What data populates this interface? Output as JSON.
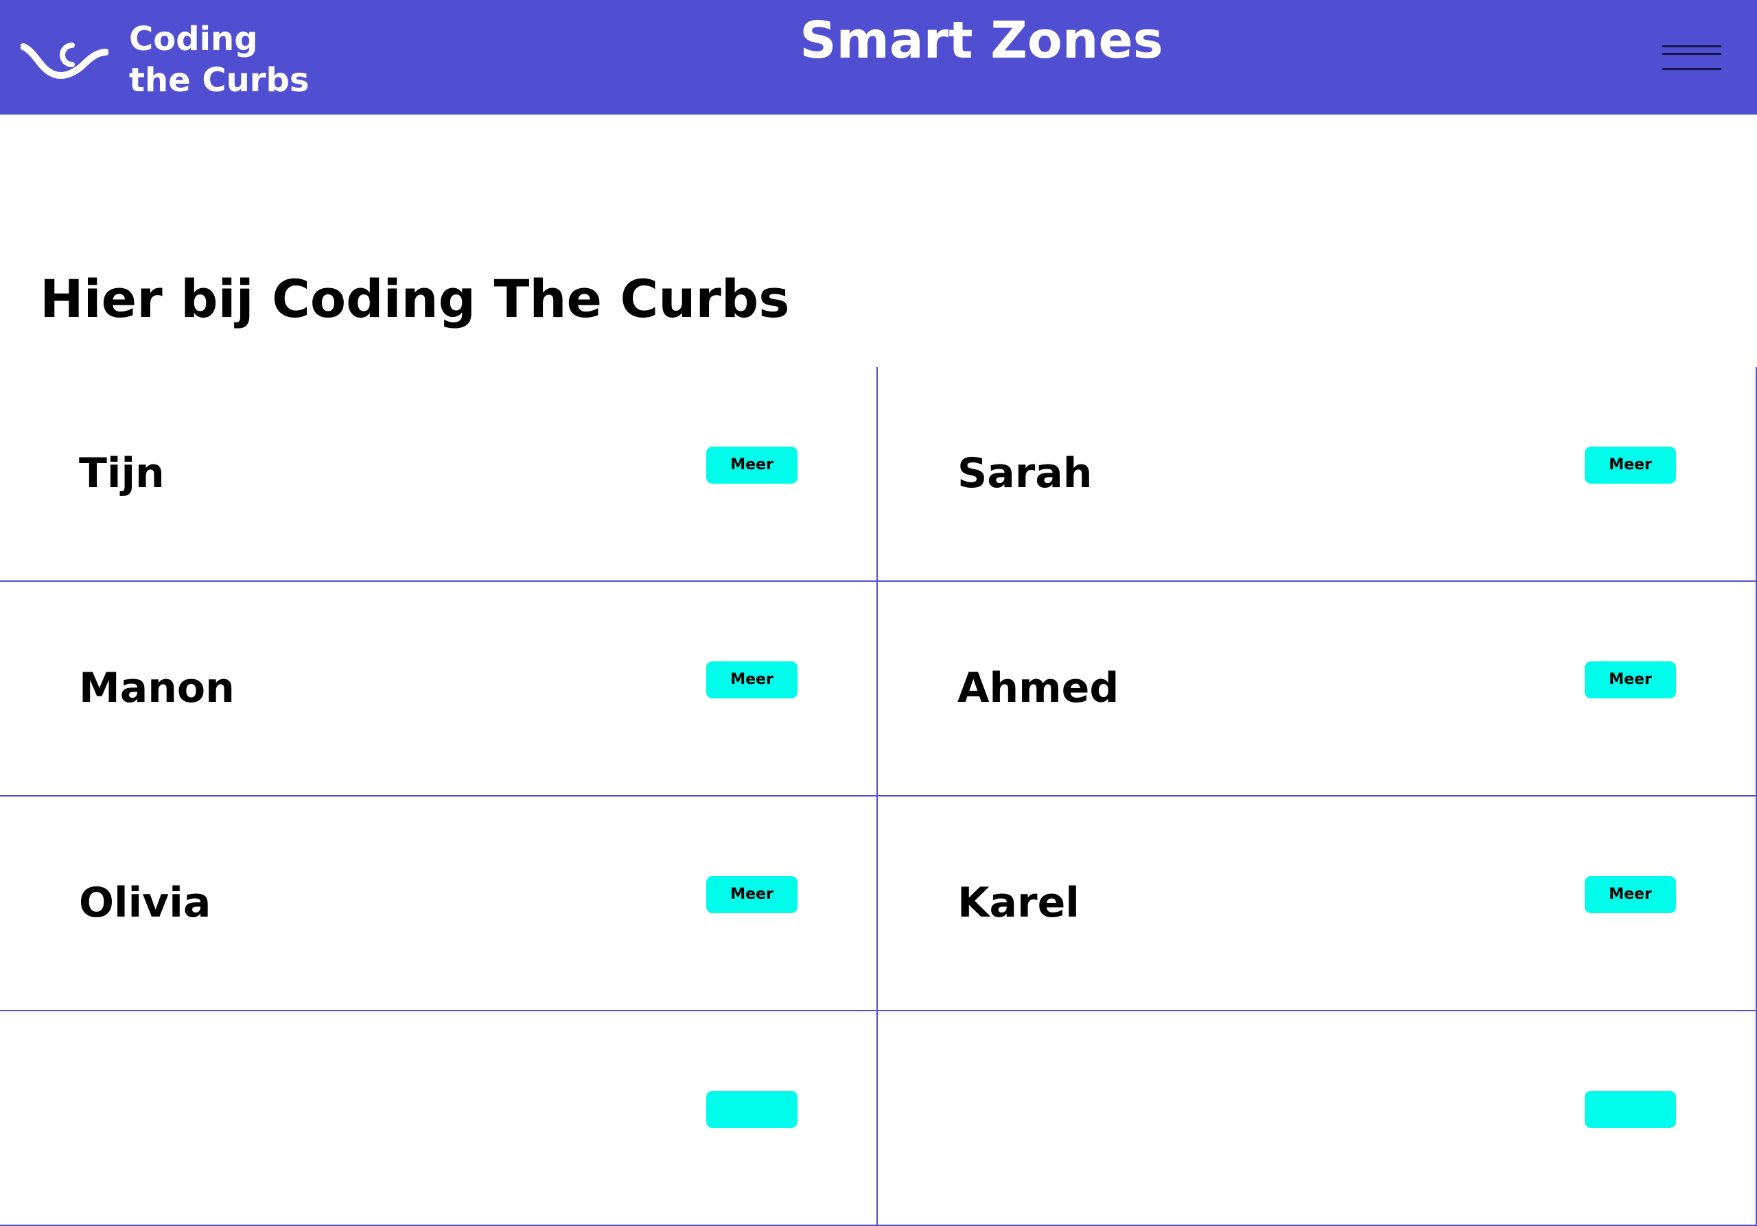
{
  "header": {
    "logo_line1": "Coding",
    "logo_line2": "the Curbs",
    "logo_icon": "coding-the-curbs-wave-c-logo",
    "title": "Smart Zones",
    "menu_icon": "hamburger-menu-icon",
    "background_color": "#514fd1"
  },
  "main": {
    "heading": "Hier bij Coding The Curbs",
    "button_color": "#00fcea",
    "border_color": "#514fd1",
    "cards": [
      {
        "name": "Tijn",
        "button_label": "Meer"
      },
      {
        "name": "Sarah",
        "button_label": "Meer"
      },
      {
        "name": "Manon",
        "button_label": "Meer"
      },
      {
        "name": "Ahmed",
        "button_label": "Meer"
      },
      {
        "name": "Olivia",
        "button_label": "Meer"
      },
      {
        "name": "Karel",
        "button_label": "Meer"
      },
      {
        "name": "",
        "button_label": ""
      },
      {
        "name": "",
        "button_label": ""
      }
    ]
  }
}
